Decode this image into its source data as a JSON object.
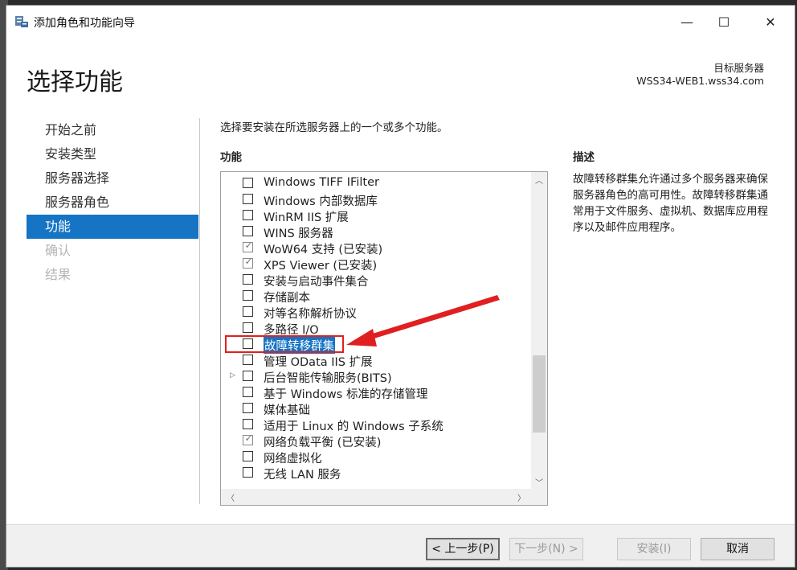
{
  "window": {
    "title": "添加角色和功能向导",
    "controls": {
      "minimize": "—",
      "maximize": "☐",
      "close": "✕"
    }
  },
  "header": {
    "page_title": "选择功能",
    "target_label": "目标服务器",
    "target_server": "WSS34-WEB1.wss34.com"
  },
  "nav": {
    "items": [
      {
        "label": "开始之前",
        "state": "normal"
      },
      {
        "label": "安装类型",
        "state": "normal"
      },
      {
        "label": "服务器选择",
        "state": "normal"
      },
      {
        "label": "服务器角色",
        "state": "normal"
      },
      {
        "label": "功能",
        "state": "active"
      },
      {
        "label": "确认",
        "state": "disabled"
      },
      {
        "label": "结果",
        "state": "disabled"
      }
    ]
  },
  "main": {
    "instruction": "选择要安装在所选服务器上的一个或多个功能。",
    "features_label": "功能",
    "description_label": "描述",
    "description_text": "故障转移群集允许通过多个服务器来确保服务器角色的高可用性。故障转移群集通常用于文件服务、虚拟机、数据库应用程序以及邮件应用程序。",
    "features": [
      {
        "label": "Windows TIFF IFilter",
        "checked": false
      },
      {
        "label": "Windows 内部数据库",
        "checked": false
      },
      {
        "label": "WinRM IIS 扩展",
        "checked": false
      },
      {
        "label": "WINS 服务器",
        "checked": false
      },
      {
        "label": "WoW64 支持 (已安装)",
        "checked": true
      },
      {
        "label": "XPS Viewer (已安装)",
        "checked": true
      },
      {
        "label": "安装与启动事件集合",
        "checked": false
      },
      {
        "label": "存储副本",
        "checked": false
      },
      {
        "label": "对等名称解析协议",
        "checked": false
      },
      {
        "label": "多路径 I/O",
        "checked": false
      },
      {
        "label": "故障转移群集",
        "checked": false,
        "selected": true
      },
      {
        "label": "管理 OData IIS 扩展",
        "checked": false
      },
      {
        "label": "后台智能传输服务(BITS)",
        "checked": false,
        "expandable": true
      },
      {
        "label": "基于 Windows 标准的存储管理",
        "checked": false
      },
      {
        "label": "媒体基础",
        "checked": false
      },
      {
        "label": "适用于 Linux 的 Windows 子系统",
        "checked": false
      },
      {
        "label": "网络负载平衡 (已安装)",
        "checked": true
      },
      {
        "label": "网络虚拟化",
        "checked": false
      },
      {
        "label": "无线 LAN 服务",
        "checked": false
      }
    ]
  },
  "footer": {
    "prev": "< 上一步(P)",
    "next": "下一步(N) >",
    "install": "安装(I)",
    "cancel": "取消"
  },
  "colors": {
    "accent": "#1574c4",
    "annotation": "#e02020"
  }
}
